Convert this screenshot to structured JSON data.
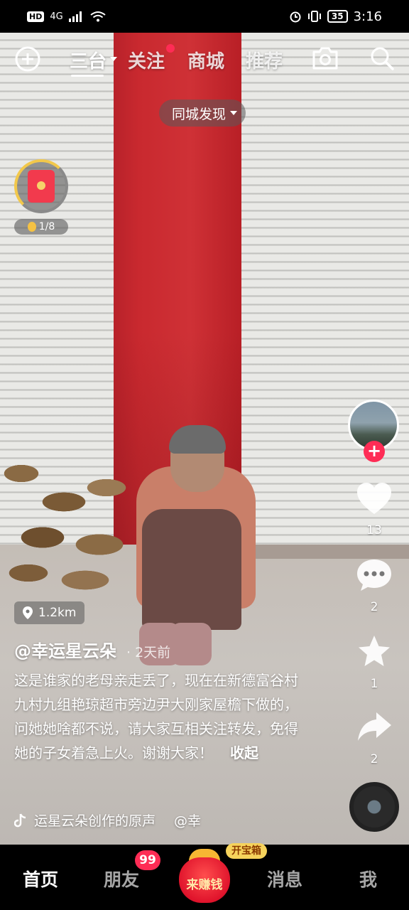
{
  "status_bar": {
    "network_hd": "HD",
    "network_type": "4G",
    "battery": "35",
    "time": "3:16"
  },
  "top_nav": {
    "tabs": [
      {
        "label": "三台",
        "active": true
      },
      {
        "label": "关注",
        "active": false,
        "has_dot": true
      },
      {
        "label": "商城",
        "active": false
      },
      {
        "label": "推荐",
        "active": false
      }
    ],
    "icons": [
      "add-circle-icon",
      "camera-icon",
      "search-icon"
    ]
  },
  "city_filter": {
    "label": "同城发现"
  },
  "red_packet": {
    "progress": "1/8"
  },
  "right_rail": {
    "likes": "13",
    "comments": "2",
    "favorites": "1",
    "shares": "2"
  },
  "post": {
    "distance": "1.2km",
    "author": "@幸运星云朵",
    "time_ago": "· 2天前",
    "caption": "这是谁家的老母亲走丢了，现在在新德富谷村九村九组艳琼超市旁边尹大刚家屋檐下做的，问她她啥都不说，请大家互相关注转发，免得她的子女着急上火。谢谢大家！",
    "collapse_label": "收起",
    "music": "运星云朵创作的原声",
    "music_author": "@幸"
  },
  "bottom_bar": {
    "home": "首页",
    "friends": "朋友",
    "friends_badge": "99",
    "earn": "来赚钱",
    "treasure": "开宝箱",
    "messages": "消息",
    "me": "我"
  },
  "colors": {
    "accent": "#fe2c55",
    "gold": "#f6d35c"
  }
}
